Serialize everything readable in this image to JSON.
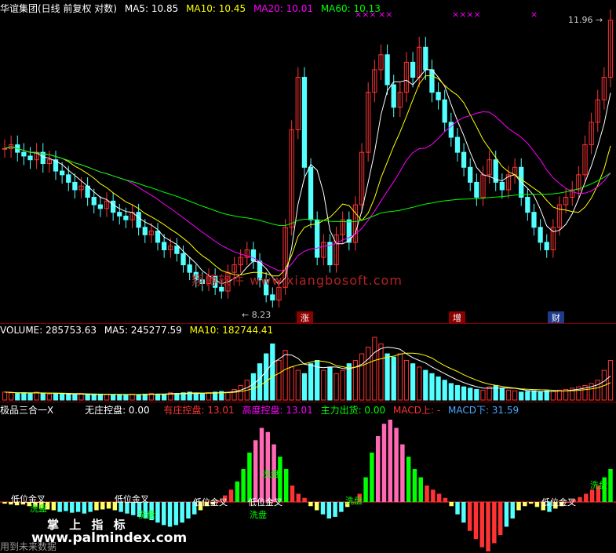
{
  "price_header": {
    "title": "华谊集团(日线 前复权 对数)",
    "ma5": "MA5: 10.85",
    "ma10": "MA10: 10.45",
    "ma20": "MA20: 10.01",
    "ma60": "MA60: 10.13"
  },
  "price_markers": {
    "high": "11.96",
    "low": "8.23",
    "x_marks": [
      "×××",
      "××",
      "××××",
      "×"
    ]
  },
  "event_tags": [
    "涨",
    "增",
    "财"
  ],
  "watermark": "翔博软件 www.xiangbosoft.com",
  "volume_header": {
    "volume": "VOLUME: 285753.63",
    "ma5": "MA5: 245277.59",
    "ma10": "MA10: 182744.41"
  },
  "indicator_header": {
    "name": "极品三合一X",
    "no_dealer": "无庄控盘: 0.00",
    "has_dealer": "有庄控盘: 13.01",
    "high_control": "高度控盘: 13.01",
    "main_exit": "主力出货: 0.00",
    "macd_up": "MACD上: -",
    "macd_down": "MACD下: 31.59"
  },
  "indicator_annotations": [
    "低位金叉",
    "洗盘",
    "低位金叉",
    "洗盘",
    "低位金叉",
    "洗盘",
    "低位金叉",
    "洗盘",
    "洗盘",
    "低位金叉",
    "洗盘"
  ],
  "footer": {
    "left_text": "用到未来数据",
    "logo_text": "掌 上 指 标",
    "site": "www.palmindex.com"
  },
  "colors": {
    "up": "#ff3333",
    "down": "#54ffff",
    "ma5": "#ffffff",
    "ma10": "#ffff00",
    "ma20": "#ff00ff",
    "ma60": "#00ff00"
  },
  "chart_data": [
    {
      "type": "candlestick",
      "title": "华谊集团(日线 前复权 对数)",
      "price_high": 11.96,
      "price_low": 8.23,
      "series": [
        {
          "name": "MA5",
          "value": 10.85
        },
        {
          "name": "MA10",
          "value": 10.45
        },
        {
          "name": "MA20",
          "value": 10.01
        },
        {
          "name": "MA60",
          "value": 10.13
        }
      ],
      "close": [
        10.25,
        10.3,
        10.2,
        10.15,
        10.1,
        10.2,
        10.05,
        10.1,
        9.95,
        9.9,
        9.8,
        9.7,
        9.75,
        9.6,
        9.5,
        9.45,
        9.55,
        9.4,
        9.35,
        9.3,
        9.4,
        9.2,
        9.1,
        9.15,
        9.0,
        8.9,
        8.95,
        8.85,
        8.7,
        8.6,
        8.5,
        8.45,
        8.55,
        8.4,
        8.35,
        8.6,
        8.7,
        8.8,
        8.9,
        8.75,
        8.5,
        8.3,
        8.23,
        8.4,
        9.2,
        10.5,
        11.2,
        10.0,
        9.3,
        8.8,
        9.0,
        8.7,
        9.1,
        9.3,
        9.0,
        9.5,
        10.2,
        11.0,
        11.3,
        11.5,
        11.1,
        10.8,
        11.0,
        11.4,
        11.2,
        11.6,
        11.3,
        11.0,
        10.9,
        10.6,
        10.4,
        10.2,
        10.0,
        9.8,
        9.6,
        9.9,
        10.1,
        9.8,
        9.7,
        9.9,
        10.0,
        9.6,
        9.4,
        9.2,
        9.0,
        8.9,
        9.2,
        9.5,
        9.6,
        9.7,
        9.9,
        10.3,
        10.6,
        10.9,
        11.2,
        11.96
      ],
      "ylabel": "",
      "grid": false
    },
    {
      "type": "bar",
      "title": "VOLUME",
      "series": [
        {
          "name": "VOLUME",
          "value": 285753.63
        },
        {
          "name": "MA5",
          "value": 245277.59
        },
        {
          "name": "MA10",
          "value": 182744.41
        }
      ],
      "values": [
        12,
        11,
        10,
        11,
        10,
        12,
        10,
        9,
        10,
        9,
        9,
        8,
        9,
        8,
        8,
        9,
        9,
        8,
        8,
        8,
        9,
        8,
        9,
        10,
        9,
        9,
        11,
        10,
        11,
        12,
        10,
        10,
        11,
        12,
        13,
        12,
        16,
        22,
        30,
        40,
        55,
        70,
        85,
        60,
        75,
        50,
        45,
        40,
        55,
        60,
        45,
        50,
        40,
        45,
        55,
        60,
        70,
        80,
        95,
        85,
        70,
        65,
        70,
        60,
        55,
        50,
        45,
        40,
        35,
        30,
        25,
        22,
        20,
        18,
        16,
        15,
        20,
        22,
        18,
        15,
        14,
        12,
        13,
        14,
        12,
        14,
        13,
        15,
        16,
        18,
        20,
        22,
        25,
        30,
        45,
        60
      ],
      "ylim": [
        0,
        300000
      ]
    },
    {
      "type": "bar",
      "title": "极品三合一X",
      "series": [
        {
          "name": "无庄控盘",
          "value": 0.0
        },
        {
          "name": "有庄控盘",
          "value": 13.01
        },
        {
          "name": "高度控盘",
          "value": 13.01
        },
        {
          "name": "主力出货",
          "value": 0.0
        },
        {
          "name": "MACD上",
          "value": null
        },
        {
          "name": "MACD下",
          "value": 31.59
        }
      ],
      "values": [
        -2,
        -3,
        -4,
        -3,
        -5,
        -6,
        -8,
        -9,
        -10,
        -12,
        -11,
        -13,
        -12,
        -14,
        -12,
        -10,
        -9,
        -8,
        -10,
        -12,
        -14,
        -16,
        -18,
        -20,
        -22,
        -25,
        -28,
        -30,
        -28,
        -25,
        -20,
        -15,
        -10,
        -5,
        -3,
        2,
        8,
        15,
        25,
        40,
        60,
        75,
        90,
        85,
        70,
        55,
        40,
        20,
        10,
        5,
        -5,
        -10,
        -15,
        -20,
        -18,
        -12,
        -6,
        0,
        10,
        30,
        60,
        80,
        95,
        100,
        90,
        70,
        55,
        40,
        30,
        20,
        15,
        10,
        5,
        -5,
        -15,
        -25,
        -35,
        -45,
        -55,
        -60,
        -50,
        -40,
        -30,
        -20,
        -10,
        -5,
        -2,
        -6,
        -10,
        -12,
        -8,
        -5,
        0,
        3,
        6,
        10,
        15,
        20,
        30,
        40
      ]
    }
  ]
}
